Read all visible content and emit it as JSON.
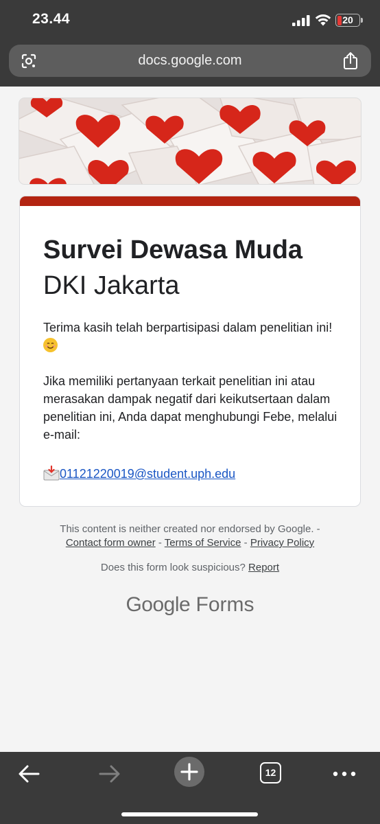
{
  "status_bar": {
    "time": "23.44",
    "battery": "20"
  },
  "browser": {
    "url": "docs.google.com"
  },
  "form": {
    "title_bold": "Survei Dewasa Muda",
    "title_regular": "DKI Jakarta",
    "thanks_text": "Terima kasih telah berpartisipasi dalam penelitian ini!",
    "contact_text": "Jika memiliki pertanyaan terkait penelitian ini atau merasakan dampak negatif dari keikutsertaan dalam penelitian ini, Anda dapat menghubungi Febe, melalui e-mail:",
    "email": "01121220019@student.uph.edu"
  },
  "footer": {
    "disclaimer": "This content is neither created nor endorsed by Google. -",
    "contact_owner": "Contact form owner",
    "terms": "Terms of Service",
    "privacy": "Privacy Policy",
    "separator": " - ",
    "suspicious": "Does this form look suspicious?",
    "report": "Report",
    "logo_google": "Google",
    "logo_forms": "Forms"
  },
  "toolbar": {
    "tab_count": "12"
  },
  "colors": {
    "accent_stripe": "#b32411",
    "link": "#1a56c4",
    "chrome_bg": "#3a3a3a"
  },
  "icons": [
    "back-icon",
    "forward-icon",
    "new-tab-icon",
    "tabs-icon",
    "more-icon",
    "lens-icon",
    "share-icon",
    "signal-icon",
    "wifi-icon",
    "battery-icon"
  ]
}
